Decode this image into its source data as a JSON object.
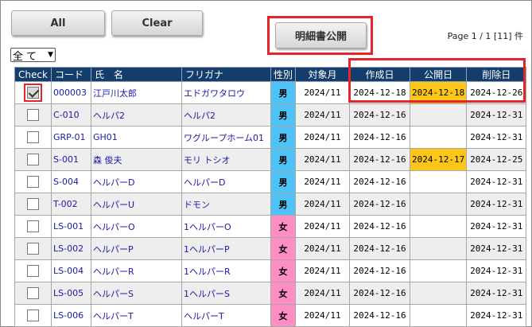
{
  "buttons": {
    "all": "All",
    "clear": "Clear",
    "publish": "明細書公開"
  },
  "page_info": "Page 1 / 1 [11] 件",
  "filter": {
    "value": "全 て",
    "chevron_icon": "chevron-down-icon"
  },
  "colors": {
    "header_bg": "#143d6b",
    "male": "#4fc3f7",
    "female": "#ff8ec4",
    "highlight_date": "#ffc61a",
    "annotation_red": "#e8242b"
  },
  "columns": [
    "Check",
    "コード",
    "氏　名",
    "フリガナ",
    "性別",
    "対象月",
    "作成日",
    "公開日",
    "削除日"
  ],
  "rows": [
    {
      "checked": true,
      "code": "000003",
      "name": "江戸川太郎",
      "kana": "エドガワタロウ",
      "gender": "男",
      "month": "2024/11",
      "created": "2024-12-18",
      "published": "2024-12-18",
      "deleted": "2024-12-26"
    },
    {
      "checked": false,
      "code": "C-010",
      "name": "ヘルパ2",
      "kana": "ヘルパ2",
      "gender": "男",
      "month": "2024/11",
      "created": "2024-12-16",
      "published": "",
      "deleted": "2024-12-31"
    },
    {
      "checked": false,
      "code": "GRP-01",
      "name": "GH01",
      "kana": "ワグループホーム01",
      "gender": "男",
      "month": "2024/11",
      "created": "2024-12-16",
      "published": "",
      "deleted": "2024-12-31"
    },
    {
      "checked": false,
      "code": "S-001",
      "name": "森 俊夫",
      "kana": "モリ トシオ",
      "gender": "男",
      "month": "2024/11",
      "created": "2024-12-16",
      "published": "2024-12-17",
      "deleted": "2024-12-25"
    },
    {
      "checked": false,
      "code": "S-004",
      "name": "ヘルパーD",
      "kana": "ヘルパーD",
      "gender": "男",
      "month": "2024/11",
      "created": "2024-12-16",
      "published": "",
      "deleted": "2024-12-31"
    },
    {
      "checked": false,
      "code": "T-002",
      "name": "ヘルパーU",
      "kana": "ドモン",
      "gender": "男",
      "month": "2024/11",
      "created": "2024-12-16",
      "published": "",
      "deleted": "2024-12-31"
    },
    {
      "checked": false,
      "code": "LS-001",
      "name": "ヘルパーO",
      "kana": "1ヘルパーO",
      "gender": "女",
      "month": "2024/11",
      "created": "2024-12-16",
      "published": "",
      "deleted": "2024-12-31"
    },
    {
      "checked": false,
      "code": "LS-002",
      "name": "ヘルパーP",
      "kana": "1ヘルパーP",
      "gender": "女",
      "month": "2024/11",
      "created": "2024-12-16",
      "published": "",
      "deleted": "2024-12-31"
    },
    {
      "checked": false,
      "code": "LS-004",
      "name": "ヘルパーR",
      "kana": "1ヘルパーR",
      "gender": "女",
      "month": "2024/11",
      "created": "2024-12-16",
      "published": "",
      "deleted": "2024-12-31"
    },
    {
      "checked": false,
      "code": "LS-005",
      "name": "ヘルパーS",
      "kana": "1ヘルパーS",
      "gender": "女",
      "month": "2024/11",
      "created": "2024-12-16",
      "published": "",
      "deleted": "2024-12-31"
    },
    {
      "checked": false,
      "code": "LS-006",
      "name": "ヘルパーT",
      "kana": "ヘルパーT",
      "gender": "女",
      "month": "2024/11",
      "created": "2024-12-16",
      "published": "",
      "deleted": "2024-12-31"
    }
  ]
}
